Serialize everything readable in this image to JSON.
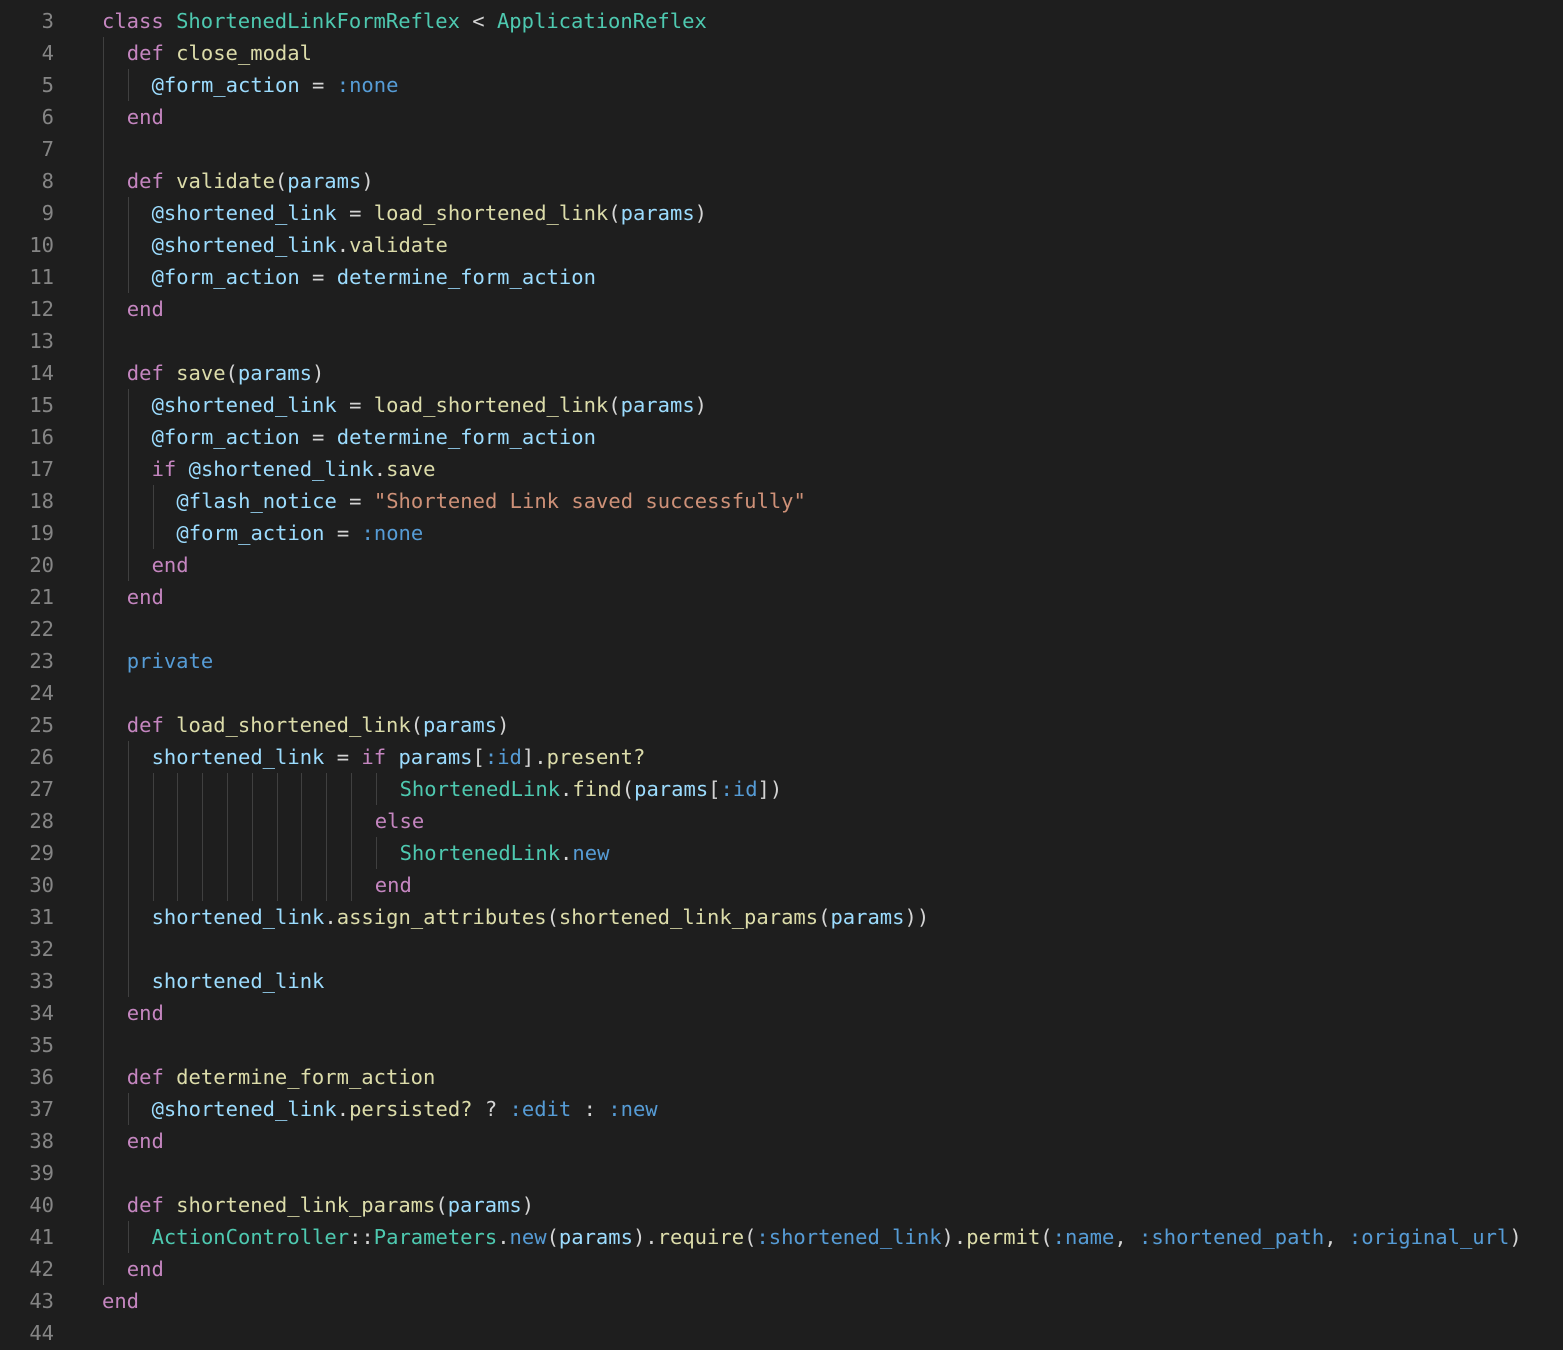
{
  "colors": {
    "background": "#1e1e1e",
    "line_number": "#858585",
    "indent_guide": "#404040",
    "keyword": "#c586c0",
    "class_name": "#4ec9b0",
    "function": "#dcdcaa",
    "variable": "#9cdcfe",
    "symbol": "#569cd6",
    "string": "#ce9178",
    "plain": "#d4d4d4"
  },
  "editor": {
    "language": "ruby",
    "first_line_number": 3,
    "lines": [
      {
        "n": "3",
        "indent": 0,
        "tokens": [
          [
            "class ",
            "kw"
          ],
          [
            "ShortenedLinkFormReflex",
            "cls"
          ],
          [
            " < ",
            "pl"
          ],
          [
            "ApplicationReflex",
            "cls"
          ]
        ]
      },
      {
        "n": "4",
        "indent": 1,
        "tokens": [
          [
            "def ",
            "kw"
          ],
          [
            "close_modal",
            "fn"
          ]
        ]
      },
      {
        "n": "5",
        "indent": 2,
        "tokens": [
          [
            "@form_action",
            "var"
          ],
          [
            " = ",
            "pl"
          ],
          [
            ":none",
            "sym"
          ]
        ]
      },
      {
        "n": "6",
        "indent": 1,
        "tokens": [
          [
            "end",
            "kw"
          ]
        ]
      },
      {
        "n": "7",
        "indent": 0,
        "tokens": []
      },
      {
        "n": "8",
        "indent": 1,
        "tokens": [
          [
            "def ",
            "kw"
          ],
          [
            "validate",
            "fn"
          ],
          [
            "(",
            "pl"
          ],
          [
            "params",
            "var"
          ],
          [
            ")",
            "pl"
          ]
        ]
      },
      {
        "n": "9",
        "indent": 2,
        "tokens": [
          [
            "@shortened_link",
            "var"
          ],
          [
            " = ",
            "pl"
          ],
          [
            "load_shortened_link",
            "fn"
          ],
          [
            "(",
            "pl"
          ],
          [
            "params",
            "var"
          ],
          [
            ")",
            "pl"
          ]
        ]
      },
      {
        "n": "10",
        "indent": 2,
        "tokens": [
          [
            "@shortened_link",
            "var"
          ],
          [
            ".",
            "pl"
          ],
          [
            "validate",
            "fn"
          ]
        ]
      },
      {
        "n": "11",
        "indent": 2,
        "tokens": [
          [
            "@form_action",
            "var"
          ],
          [
            " = ",
            "pl"
          ],
          [
            "determine_form_action",
            "var"
          ]
        ]
      },
      {
        "n": "12",
        "indent": 1,
        "tokens": [
          [
            "end",
            "kw"
          ]
        ]
      },
      {
        "n": "13",
        "indent": 0,
        "tokens": []
      },
      {
        "n": "14",
        "indent": 1,
        "tokens": [
          [
            "def ",
            "kw"
          ],
          [
            "save",
            "fn"
          ],
          [
            "(",
            "pl"
          ],
          [
            "params",
            "var"
          ],
          [
            ")",
            "pl"
          ]
        ]
      },
      {
        "n": "15",
        "indent": 2,
        "tokens": [
          [
            "@shortened_link",
            "var"
          ],
          [
            " = ",
            "pl"
          ],
          [
            "load_shortened_link",
            "fn"
          ],
          [
            "(",
            "pl"
          ],
          [
            "params",
            "var"
          ],
          [
            ")",
            "pl"
          ]
        ]
      },
      {
        "n": "16",
        "indent": 2,
        "tokens": [
          [
            "@form_action",
            "var"
          ],
          [
            " = ",
            "pl"
          ],
          [
            "determine_form_action",
            "var"
          ]
        ]
      },
      {
        "n": "17",
        "indent": 2,
        "tokens": [
          [
            "if ",
            "kw"
          ],
          [
            "@shortened_link",
            "var"
          ],
          [
            ".",
            "pl"
          ],
          [
            "save",
            "fn"
          ]
        ]
      },
      {
        "n": "18",
        "indent": 3,
        "tokens": [
          [
            "@flash_notice",
            "var"
          ],
          [
            " = ",
            "pl"
          ],
          [
            "\"Shortened Link saved successfully\"",
            "str"
          ]
        ]
      },
      {
        "n": "19",
        "indent": 3,
        "tokens": [
          [
            "@form_action",
            "var"
          ],
          [
            " = ",
            "pl"
          ],
          [
            ":none",
            "sym"
          ]
        ]
      },
      {
        "n": "20",
        "indent": 2,
        "tokens": [
          [
            "end",
            "kw"
          ]
        ]
      },
      {
        "n": "21",
        "indent": 1,
        "tokens": [
          [
            "end",
            "kw"
          ]
        ]
      },
      {
        "n": "22",
        "indent": 0,
        "tokens": []
      },
      {
        "n": "23",
        "indent": 1,
        "tokens": [
          [
            "private",
            "sym"
          ]
        ]
      },
      {
        "n": "24",
        "indent": 0,
        "tokens": []
      },
      {
        "n": "25",
        "indent": 1,
        "tokens": [
          [
            "def ",
            "kw"
          ],
          [
            "load_shortened_link",
            "fn"
          ],
          [
            "(",
            "pl"
          ],
          [
            "params",
            "var"
          ],
          [
            ")",
            "pl"
          ]
        ]
      },
      {
        "n": "26",
        "indent": 2,
        "tokens": [
          [
            "shortened_link",
            "var"
          ],
          [
            " = ",
            "pl"
          ],
          [
            "if ",
            "kw"
          ],
          [
            "params",
            "var"
          ],
          [
            "[",
            "pl"
          ],
          [
            ":id",
            "sym"
          ],
          [
            "].",
            "pl"
          ],
          [
            "present?",
            "fn"
          ]
        ]
      },
      {
        "n": "27",
        "indent": 12,
        "tokens": [
          [
            "ShortenedLink",
            "cls"
          ],
          [
            ".",
            "pl"
          ],
          [
            "find",
            "fn"
          ],
          [
            "(",
            "pl"
          ],
          [
            "params",
            "var"
          ],
          [
            "[",
            "pl"
          ],
          [
            ":id",
            "sym"
          ],
          [
            "])",
            "pl"
          ]
        ]
      },
      {
        "n": "28",
        "indent": 11,
        "tokens": [
          [
            "else",
            "kw"
          ]
        ]
      },
      {
        "n": "29",
        "indent": 12,
        "tokens": [
          [
            "ShortenedLink",
            "cls"
          ],
          [
            ".",
            "pl"
          ],
          [
            "new",
            "sym"
          ]
        ]
      },
      {
        "n": "30",
        "indent": 11,
        "tokens": [
          [
            "end",
            "kw"
          ]
        ]
      },
      {
        "n": "31",
        "indent": 2,
        "tokens": [
          [
            "shortened_link",
            "var"
          ],
          [
            ".",
            "pl"
          ],
          [
            "assign_attributes",
            "fn"
          ],
          [
            "(",
            "pl"
          ],
          [
            "shortened_link_params",
            "fn"
          ],
          [
            "(",
            "pl"
          ],
          [
            "params",
            "var"
          ],
          [
            "))",
            "pl"
          ]
        ]
      },
      {
        "n": "32",
        "indent": 0,
        "tokens": []
      },
      {
        "n": "33",
        "indent": 2,
        "tokens": [
          [
            "shortened_link",
            "var"
          ]
        ]
      },
      {
        "n": "34",
        "indent": 1,
        "tokens": [
          [
            "end",
            "kw"
          ]
        ]
      },
      {
        "n": "35",
        "indent": 0,
        "tokens": []
      },
      {
        "n": "36",
        "indent": 1,
        "tokens": [
          [
            "def ",
            "kw"
          ],
          [
            "determine_form_action",
            "fn"
          ]
        ]
      },
      {
        "n": "37",
        "indent": 2,
        "tokens": [
          [
            "@shortened_link",
            "var"
          ],
          [
            ".",
            "pl"
          ],
          [
            "persisted?",
            "fn"
          ],
          [
            " ? ",
            "pl"
          ],
          [
            ":edit",
            "sym"
          ],
          [
            " : ",
            "pl"
          ],
          [
            ":new",
            "sym"
          ]
        ]
      },
      {
        "n": "38",
        "indent": 1,
        "tokens": [
          [
            "end",
            "kw"
          ]
        ]
      },
      {
        "n": "39",
        "indent": 0,
        "tokens": []
      },
      {
        "n": "40",
        "indent": 1,
        "tokens": [
          [
            "def ",
            "kw"
          ],
          [
            "shortened_link_params",
            "fn"
          ],
          [
            "(",
            "pl"
          ],
          [
            "params",
            "var"
          ],
          [
            ")",
            "pl"
          ]
        ]
      },
      {
        "n": "41",
        "indent": 2,
        "tokens": [
          [
            "ActionController",
            "cls"
          ],
          [
            "::",
            "pl"
          ],
          [
            "Parameters",
            "cls"
          ],
          [
            ".",
            "pl"
          ],
          [
            "new",
            "sym"
          ],
          [
            "(",
            "pl"
          ],
          [
            "params",
            "var"
          ],
          [
            ").",
            "pl"
          ],
          [
            "require",
            "fn"
          ],
          [
            "(",
            "pl"
          ],
          [
            ":shortened_link",
            "sym"
          ],
          [
            ").",
            "pl"
          ],
          [
            "permit",
            "fn"
          ],
          [
            "(",
            "pl"
          ],
          [
            ":name",
            "sym"
          ],
          [
            ", ",
            "pl"
          ],
          [
            ":shortened_path",
            "sym"
          ],
          [
            ", ",
            "pl"
          ],
          [
            ":original_url",
            "sym"
          ],
          [
            ")",
            "pl"
          ]
        ]
      },
      {
        "n": "42",
        "indent": 1,
        "tokens": [
          [
            "end",
            "kw"
          ]
        ]
      },
      {
        "n": "43",
        "indent": 0,
        "tokens": [
          [
            "end",
            "kw"
          ]
        ]
      },
      {
        "n": "44",
        "indent": 0,
        "tokens": []
      }
    ]
  }
}
